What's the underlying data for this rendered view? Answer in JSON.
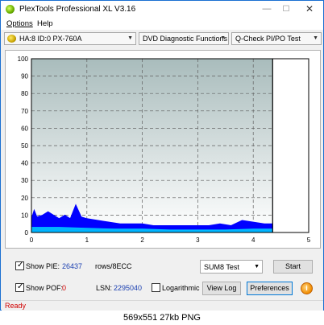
{
  "window": {
    "title": "PlexTools Professional XL V3.16",
    "icon": "plextools-icon"
  },
  "menu": {
    "options": "Options",
    "help": "Help"
  },
  "toolbar": {
    "drive": "HA:8 ID:0  PX-760A",
    "function": "DVD Diagnostic Functions",
    "test": "Q-Check  PI/PO Test"
  },
  "chart_data": {
    "type": "area",
    "title": "",
    "xlabel": "",
    "ylabel": "",
    "xlim": [
      0,
      5
    ],
    "ylim": [
      0,
      100
    ],
    "x_ticks": [
      "0",
      "1",
      "2",
      "3",
      "4",
      "5"
    ],
    "y_ticks": [
      "100",
      "90",
      "80",
      "70",
      "60",
      "50",
      "40",
      "30",
      "20",
      "10",
      "0"
    ],
    "grid": true,
    "background": "#a9bcbc",
    "end_marker_x": 4.35,
    "series": [
      {
        "color": "#0000ff",
        "x": [
          0.0,
          0.05,
          0.1,
          0.2,
          0.3,
          0.45,
          0.5,
          0.6,
          0.7,
          0.8,
          0.9,
          1.0,
          1.2,
          1.4,
          1.6,
          1.8,
          2.0,
          2.2,
          2.4,
          2.6,
          2.8,
          3.0,
          3.2,
          3.4,
          3.6,
          3.8,
          4.0,
          4.2,
          4.35
        ],
        "values": [
          8,
          13,
          9,
          10,
          12,
          9,
          8,
          10,
          8,
          16,
          9,
          8,
          7,
          6,
          5,
          5,
          5,
          4,
          4,
          4,
          4,
          4,
          4,
          5,
          4,
          7,
          6,
          5,
          5
        ]
      },
      {
        "color": "#00c8ff",
        "x": [
          0.0,
          0.5,
          1.0,
          1.5,
          2.0,
          2.5,
          3.0,
          3.5,
          4.0,
          4.35
        ],
        "values": [
          3,
          3,
          2.5,
          2,
          2,
          1.5,
          1.5,
          1.5,
          2,
          2
        ]
      }
    ]
  },
  "controls": {
    "show_pie_label": "Show PIE:",
    "pie_value": "26437",
    "pie_unit": "rows/8ECC",
    "show_pof_label": "Show POF:",
    "pof_value": "0",
    "lsn_label": "LSN:",
    "lsn_value": "2295040",
    "logarithmic_label": "Logarithmic",
    "test_select": "SUM8 Test",
    "start_button": "Start",
    "view_log_button": "View Log",
    "preferences_button": "Preferences",
    "info_button": "i"
  },
  "status": {
    "text": "Ready"
  },
  "caption": "569x551  27kb  PNG"
}
